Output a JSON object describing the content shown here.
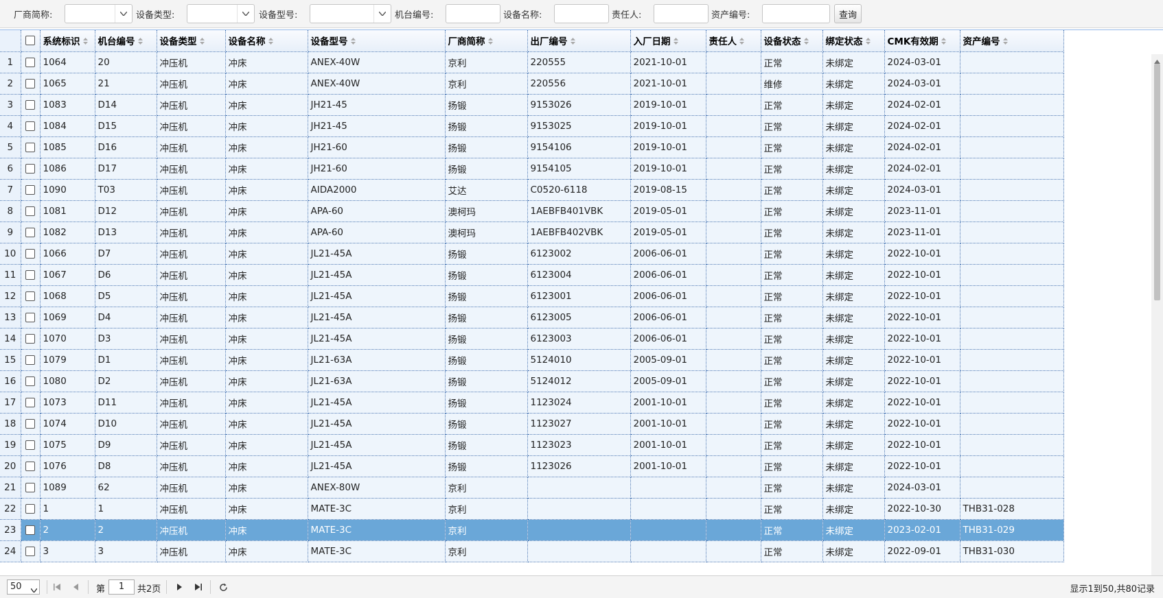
{
  "toolbar": {
    "vendor_label": "厂商简称:",
    "type_label": "设备类型:",
    "model_label": "设备型号:",
    "machine_no_label": "机台编号:",
    "name_label": "设备名称:",
    "owner_label": "责任人:",
    "asset_no_label": "资产编号:",
    "query_label": "查询"
  },
  "columns": [
    "系统标识",
    "机台编号",
    "设备类型",
    "设备名称",
    "设备型号",
    "厂商简称",
    "出厂编号",
    "入厂日期",
    "责任人",
    "设备状态",
    "绑定状态",
    "CMK有效期",
    "资产编号"
  ],
  "rows": [
    {
      "n": "1",
      "c": [
        "1064",
        "20",
        "冲压机",
        "冲床",
        "ANEX-40W",
        "京利",
        "220555",
        "2021-10-01",
        "",
        "正常",
        "未绑定",
        "2024-03-01",
        ""
      ]
    },
    {
      "n": "2",
      "c": [
        "1065",
        "21",
        "冲压机",
        "冲床",
        "ANEX-40W",
        "京利",
        "220556",
        "2021-10-01",
        "",
        "维修",
        "未绑定",
        "2024-03-01",
        ""
      ]
    },
    {
      "n": "3",
      "c": [
        "1083",
        "D14",
        "冲压机",
        "冲床",
        "JH21-45",
        "扬锻",
        "9153026",
        "2019-10-01",
        "",
        "正常",
        "未绑定",
        "2024-02-01",
        ""
      ]
    },
    {
      "n": "4",
      "c": [
        "1084",
        "D15",
        "冲压机",
        "冲床",
        "JH21-45",
        "扬锻",
        "9153025",
        "2019-10-01",
        "",
        "正常",
        "未绑定",
        "2024-02-01",
        ""
      ]
    },
    {
      "n": "5",
      "c": [
        "1085",
        "D16",
        "冲压机",
        "冲床",
        "JH21-60",
        "扬锻",
        "9154106",
        "2019-10-01",
        "",
        "正常",
        "未绑定",
        "2024-02-01",
        ""
      ]
    },
    {
      "n": "6",
      "c": [
        "1086",
        "D17",
        "冲压机",
        "冲床",
        "JH21-60",
        "扬锻",
        "9154105",
        "2019-10-01",
        "",
        "正常",
        "未绑定",
        "2024-02-01",
        ""
      ]
    },
    {
      "n": "7",
      "c": [
        "1090",
        "T03",
        "冲压机",
        "冲床",
        "AIDA2000",
        "艾达",
        "C0520-6118",
        "2019-08-15",
        "",
        "正常",
        "未绑定",
        "2024-03-01",
        ""
      ]
    },
    {
      "n": "8",
      "c": [
        "1081",
        "D12",
        "冲压机",
        "冲床",
        "APA-60",
        "澳柯玛",
        "1AEBFB401VBK",
        "2019-05-01",
        "",
        "正常",
        "未绑定",
        "2023-11-01",
        ""
      ]
    },
    {
      "n": "9",
      "c": [
        "1082",
        "D13",
        "冲压机",
        "冲床",
        "APA-60",
        "澳柯玛",
        "1AEBFB402VBK",
        "2019-05-01",
        "",
        "正常",
        "未绑定",
        "2023-11-01",
        ""
      ]
    },
    {
      "n": "10",
      "c": [
        "1066",
        "D7",
        "冲压机",
        "冲床",
        "JL21-45A",
        "扬锻",
        "6123002",
        "2006-06-01",
        "",
        "正常",
        "未绑定",
        "2022-10-01",
        ""
      ]
    },
    {
      "n": "11",
      "c": [
        "1067",
        "D6",
        "冲压机",
        "冲床",
        "JL21-45A",
        "扬锻",
        "6123004",
        "2006-06-01",
        "",
        "正常",
        "未绑定",
        "2022-10-01",
        ""
      ]
    },
    {
      "n": "12",
      "c": [
        "1068",
        "D5",
        "冲压机",
        "冲床",
        "JL21-45A",
        "扬锻",
        "6123001",
        "2006-06-01",
        "",
        "正常",
        "未绑定",
        "2022-10-01",
        ""
      ]
    },
    {
      "n": "13",
      "c": [
        "1069",
        "D4",
        "冲压机",
        "冲床",
        "JL21-45A",
        "扬锻",
        "6123005",
        "2006-06-01",
        "",
        "正常",
        "未绑定",
        "2022-10-01",
        ""
      ]
    },
    {
      "n": "14",
      "c": [
        "1070",
        "D3",
        "冲压机",
        "冲床",
        "JL21-45A",
        "扬锻",
        "6123003",
        "2006-06-01",
        "",
        "正常",
        "未绑定",
        "2022-10-01",
        ""
      ]
    },
    {
      "n": "15",
      "c": [
        "1079",
        "D1",
        "冲压机",
        "冲床",
        "JL21-63A",
        "扬锻",
        "5124010",
        "2005-09-01",
        "",
        "正常",
        "未绑定",
        "2022-10-01",
        ""
      ]
    },
    {
      "n": "16",
      "c": [
        "1080",
        "D2",
        "冲压机",
        "冲床",
        "JL21-63A",
        "扬锻",
        "5124012",
        "2005-09-01",
        "",
        "正常",
        "未绑定",
        "2022-10-01",
        ""
      ]
    },
    {
      "n": "17",
      "c": [
        "1073",
        "D11",
        "冲压机",
        "冲床",
        "JL21-45A",
        "扬锻",
        "1123024",
        "2001-10-01",
        "",
        "正常",
        "未绑定",
        "2022-10-01",
        ""
      ]
    },
    {
      "n": "18",
      "c": [
        "1074",
        "D10",
        "冲压机",
        "冲床",
        "JL21-45A",
        "扬锻",
        "1123027",
        "2001-10-01",
        "",
        "正常",
        "未绑定",
        "2022-10-01",
        ""
      ]
    },
    {
      "n": "19",
      "c": [
        "1075",
        "D9",
        "冲压机",
        "冲床",
        "JL21-45A",
        "扬锻",
        "1123023",
        "2001-10-01",
        "",
        "正常",
        "未绑定",
        "2022-10-01",
        ""
      ]
    },
    {
      "n": "20",
      "c": [
        "1076",
        "D8",
        "冲压机",
        "冲床",
        "JL21-45A",
        "扬锻",
        "1123026",
        "2001-10-01",
        "",
        "正常",
        "未绑定",
        "2022-10-01",
        ""
      ]
    },
    {
      "n": "21",
      "c": [
        "1089",
        "62",
        "冲压机",
        "冲床",
        "ANEX-80W",
        "京利",
        "",
        "",
        "",
        "正常",
        "未绑定",
        "2024-03-01",
        ""
      ]
    },
    {
      "n": "22",
      "c": [
        "1",
        "1",
        "冲压机",
        "冲床",
        "MATE-3C",
        "京利",
        "",
        "",
        "",
        "正常",
        "未绑定",
        "2022-10-30",
        "THB31-028"
      ]
    },
    {
      "n": "23",
      "c": [
        "2",
        "2",
        "冲压机",
        "冲床",
        "MATE-3C",
        "京利",
        "",
        "",
        "",
        "正常",
        "未绑定",
        "2023-02-01",
        "THB31-029"
      ],
      "selected": true
    },
    {
      "n": "24",
      "c": [
        "3",
        "3",
        "冲压机",
        "冲床",
        "MATE-3C",
        "京利",
        "",
        "",
        "",
        "正常",
        "未绑定",
        "2022-09-01",
        "THB31-030"
      ]
    }
  ],
  "pager": {
    "page_size": "50",
    "page_prefix": "第",
    "page_value": "1",
    "page_suffix": "共2页",
    "info": "显示1到50,共80记录"
  },
  "colors": {
    "selected_row": "#6aa7d8",
    "row_bg": "#eef5fc",
    "grid_line": "#3f6fb0"
  },
  "icons": {
    "dropdown": "chevron-down-icon",
    "sort": "sort-icon",
    "first": "first-page-icon",
    "prev": "prev-page-icon",
    "next": "next-page-icon",
    "last": "last-page-icon",
    "refresh": "refresh-icon"
  }
}
